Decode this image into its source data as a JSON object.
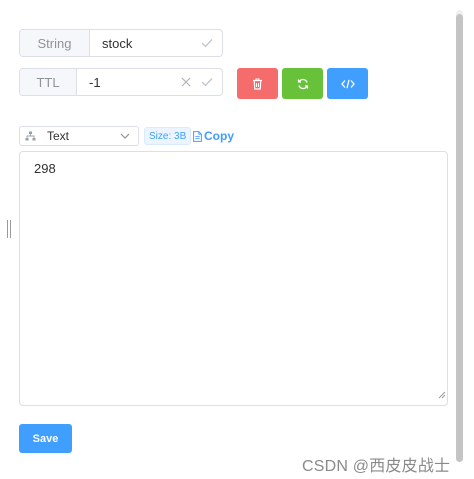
{
  "type_field": {
    "label": "String",
    "value": "stock",
    "confirm_icon": "check-icon"
  },
  "ttl_field": {
    "label": "TTL",
    "value": "-1",
    "clear_icon": "close-icon",
    "confirm_icon": "check-icon"
  },
  "actions": {
    "delete": {
      "icon": "trash-icon",
      "color": "#f56c6c"
    },
    "refresh": {
      "icon": "refresh-icon",
      "color": "#67c23a"
    },
    "code": {
      "icon": "code-icon",
      "color": "#409eff"
    }
  },
  "viewer": {
    "format": "Text",
    "format_icon": "tree-icon",
    "size_badge": "Size: 3B",
    "copy_label": "Copy",
    "content": "298"
  },
  "save_label": "Save",
  "watermark": "CSDN @西皮皮战士",
  "colors": {
    "primary": "#409eff",
    "danger": "#f56c6c",
    "success": "#67c23a"
  }
}
